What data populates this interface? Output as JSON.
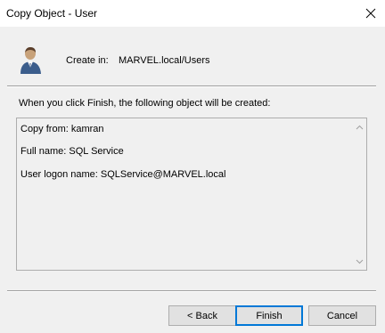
{
  "window": {
    "title": "Copy Object - User",
    "close_icon": "close-icon"
  },
  "header": {
    "icon": "user-icon",
    "create_in_label": "Create in:",
    "create_in_path": "MARVEL.local/Users"
  },
  "body": {
    "info_text": "When you click Finish, the following object will be created:",
    "summary_lines": [
      "Copy from: kamran",
      "Full name: SQL Service",
      "User logon name: SQLService@MARVEL.local"
    ]
  },
  "buttons": {
    "back": "< Back",
    "finish": "Finish",
    "cancel": "Cancel"
  }
}
